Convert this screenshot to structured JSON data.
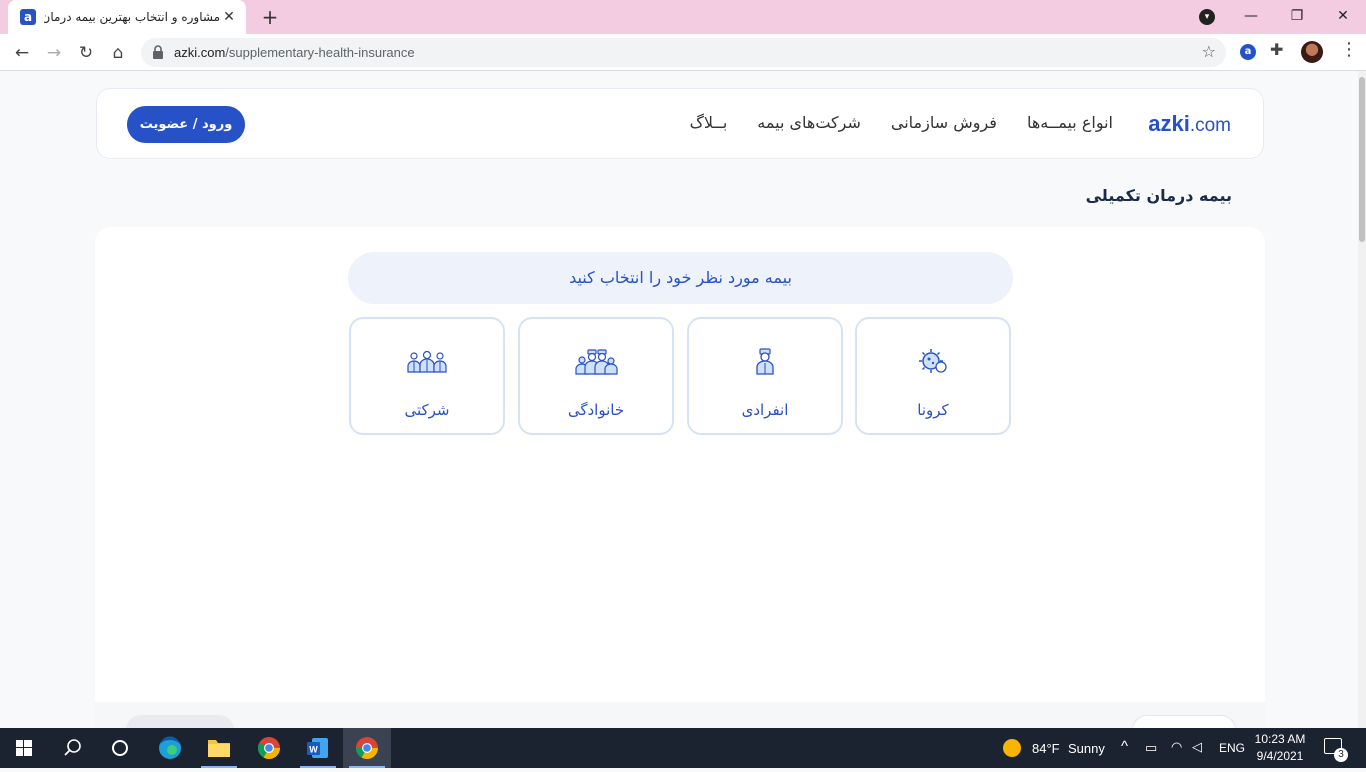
{
  "browser": {
    "tab_title": "مشاوره و انتخاب بهترین بیمه درمان",
    "tab_favicon": "a",
    "url_host": "azki.com",
    "url_path": "/supplementary-health-insurance"
  },
  "header": {
    "logo_brand": "azki",
    "logo_tld": ".com",
    "nav": [
      "انواع بیمــه‌ها",
      "فروش سازمانی",
      "شرکت‌های بیمه",
      "بــلاگ"
    ],
    "login_label": "ورود / عضویت"
  },
  "page": {
    "heading": "بیمه درمان تکمیلی",
    "prompt": "بیمه مورد نظر خود را انتخاب کنید",
    "options": [
      {
        "label": "کرونا",
        "icon": "virus-icon"
      },
      {
        "label": "انفرادی",
        "icon": "person-icon"
      },
      {
        "label": "خانوادگی",
        "icon": "family-icon"
      },
      {
        "label": "شرکتی",
        "icon": "team-icon"
      }
    ]
  },
  "taskbar": {
    "weather_temp": "84°F",
    "weather_text": "Sunny",
    "language": "ENG",
    "time": "10:23 AM",
    "date": "9/4/2021",
    "notifications": "3"
  },
  "colors": {
    "brand": "#2751c6",
    "tab_strip": "#f4cce1",
    "option_border": "#d6e3f7"
  }
}
